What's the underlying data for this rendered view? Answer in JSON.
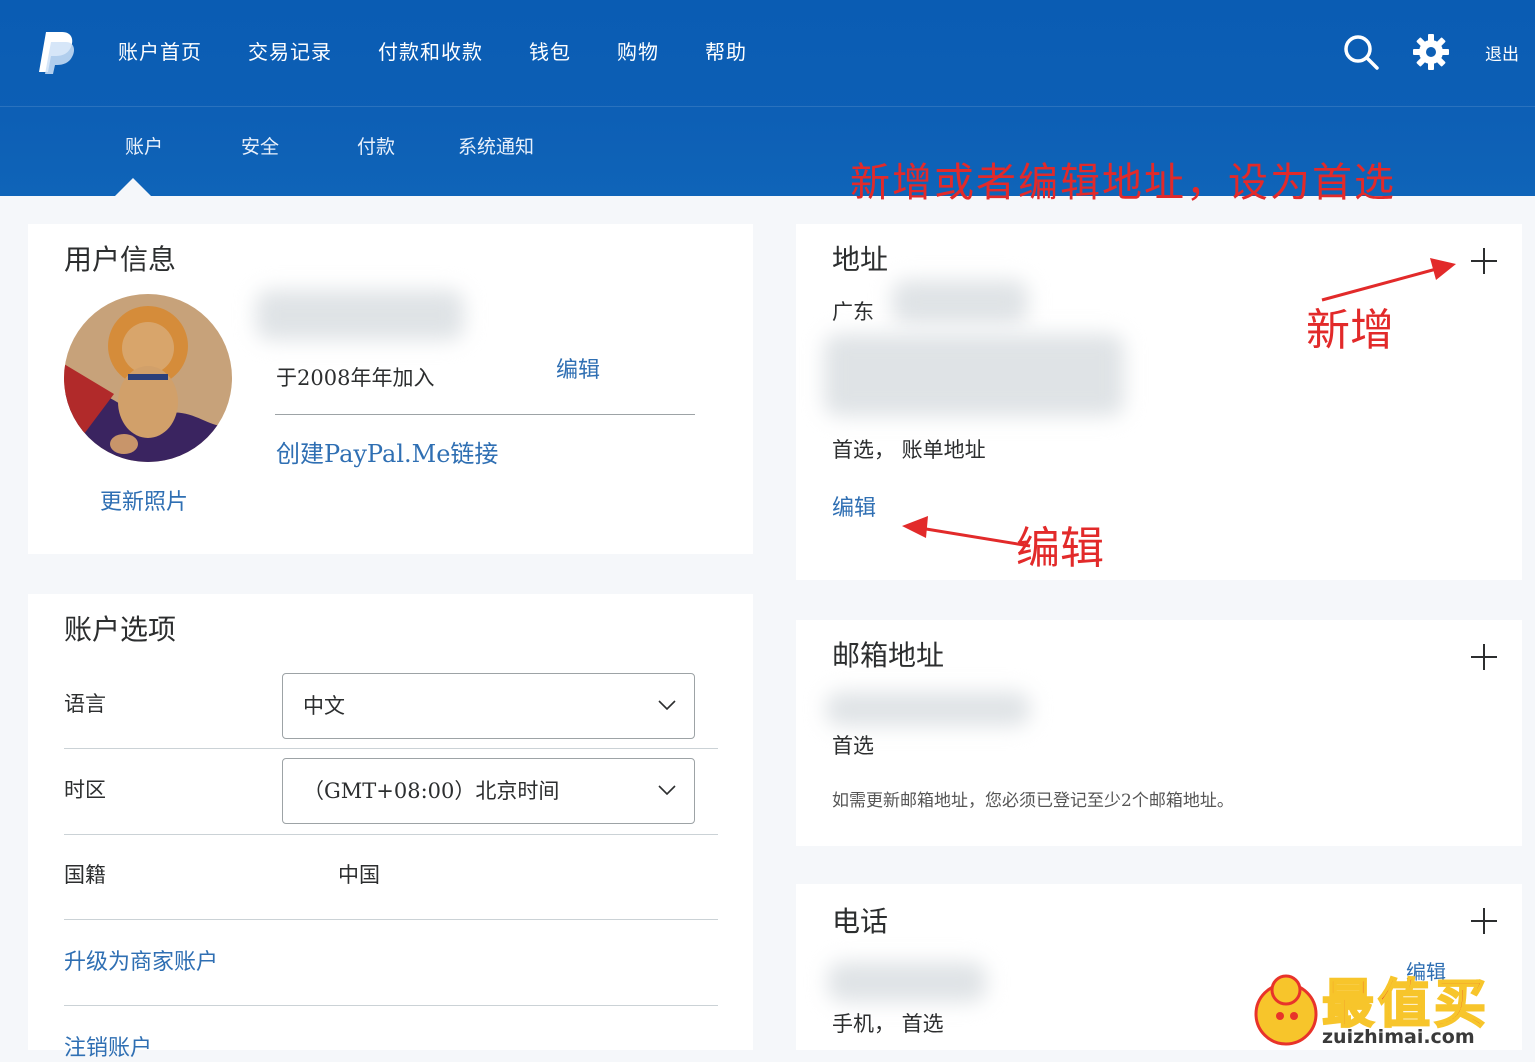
{
  "header": {
    "nav": [
      "账户首页",
      "交易记录",
      "付款和收款",
      "钱包",
      "购物",
      "帮助"
    ],
    "logout": "退出",
    "subnav": [
      "账户",
      "安全",
      "付款",
      "系统通知"
    ]
  },
  "annotations": {
    "title": "新增或者编辑地址，设为首选",
    "add_label": "新增",
    "edit_label": "编辑"
  },
  "user_info": {
    "title": "用户信息",
    "joined": "于2008年年加入",
    "edit": "编辑",
    "paypal_me": "创建PayPal.Me链接",
    "update_photo": "更新照片"
  },
  "account_options": {
    "title": "账户选项",
    "language_label": "语言",
    "language_value": "中文",
    "timezone_label": "时区",
    "timezone_value": "（GMT+08:00）北京时间",
    "nationality_label": "国籍",
    "nationality_value": "中国",
    "upgrade": "升级为商家账户",
    "close_account": "注销账户"
  },
  "address": {
    "title": "地址",
    "province": "广东",
    "status": "首选，  账单地址",
    "edit": "编辑"
  },
  "email": {
    "title": "邮箱地址",
    "status": "首选",
    "note": "如需更新邮箱地址，您必须已登记至少2个邮箱地址。"
  },
  "phone": {
    "title": "电话",
    "status": "手机， 首选",
    "edit": "编辑"
  },
  "watermark": {
    "text": "最值买",
    "domain": "zuizhimai.com"
  }
}
